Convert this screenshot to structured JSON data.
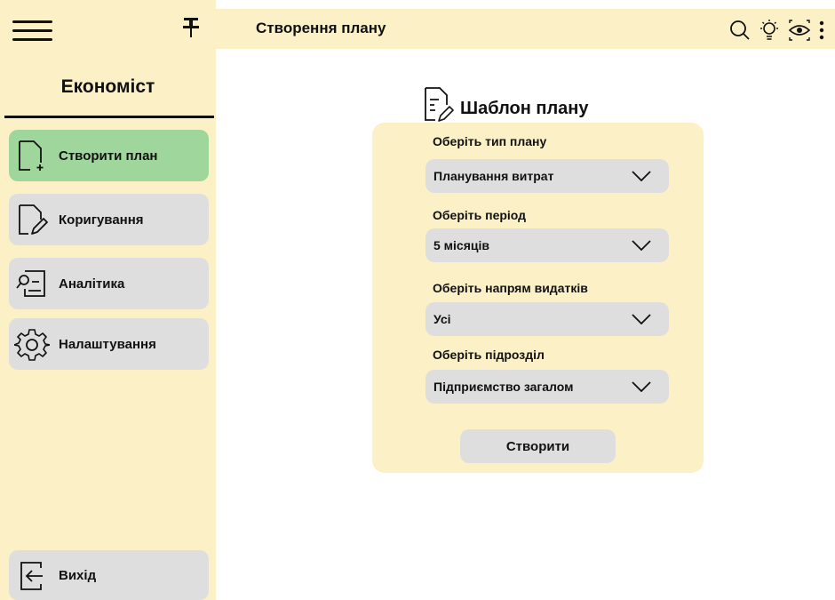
{
  "header": {
    "page_title": "Створення плану",
    "icons": [
      "search-icon",
      "lightbulb-icon",
      "eye-icon",
      "more-vertical-icon"
    ]
  },
  "sidebar": {
    "app_title": "Економіст",
    "items": [
      {
        "label": "Створити план",
        "icon": "new-document-icon",
        "active": true
      },
      {
        "label": "Коригування",
        "icon": "edit-document-icon",
        "active": false
      },
      {
        "label": "Аналітика",
        "icon": "analytics-icon",
        "active": false
      },
      {
        "label": "Налаштування",
        "icon": "gear-icon",
        "active": false
      }
    ],
    "exit_label": "Вихід"
  },
  "form": {
    "title": "Шаблон плану",
    "fields": [
      {
        "label": "Оберіть тип плану",
        "value": "Планування витрат"
      },
      {
        "label": "Оберіть період",
        "value": "5 місяців"
      },
      {
        "label": "Оберіть напрям видатків",
        "value": "Усі"
      },
      {
        "label": "Оберіть підрозділ",
        "value": "Підприємство загалом"
      }
    ],
    "submit_label": "Створити"
  },
  "colors": {
    "panel": "#fbf0c6",
    "active_item": "#9fd69b",
    "control": "#dedede"
  }
}
